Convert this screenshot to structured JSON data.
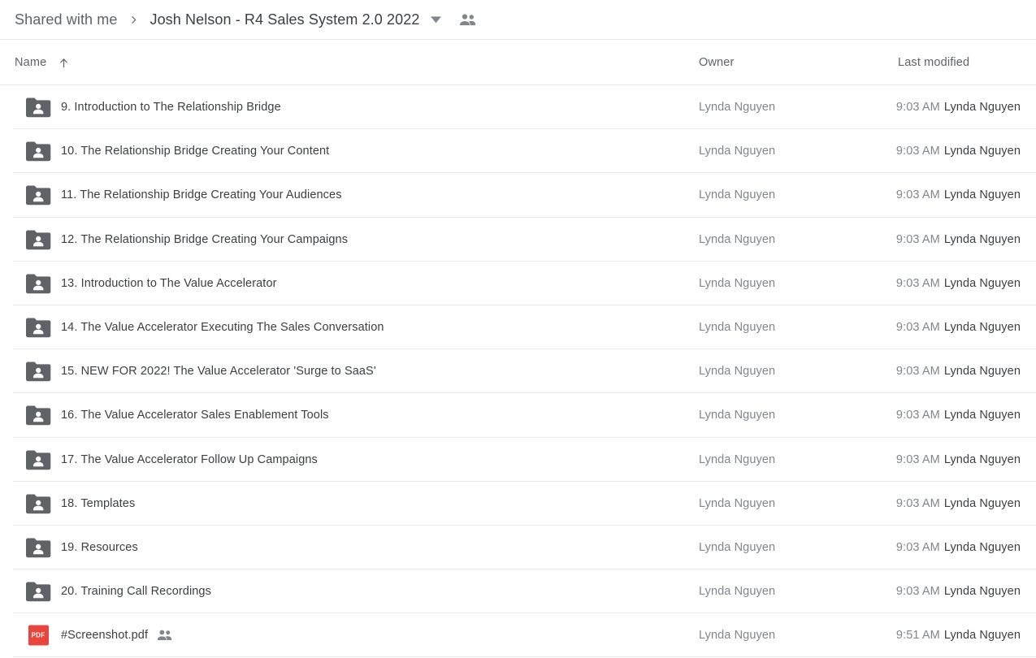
{
  "breadcrumb": {
    "parent_label": "Shared with me",
    "separator_icon": "chevron-right-icon",
    "current_label": "Josh Nelson - R4 Sales System 2.0 2022",
    "caret_icon": "chevron-down-icon",
    "shared_icon": "people-icon"
  },
  "columns": {
    "name_label": "Name",
    "sort_icon": "arrow-up-icon",
    "owner_label": "Owner",
    "modified_label": "Last modified"
  },
  "colors": {
    "folder_icon": "#5f6368",
    "pdf_badge": "#e8453c",
    "divider": "#e8eaed",
    "text_primary": "#3c4043",
    "text_secondary": "#5f6368",
    "text_muted": "#80868b"
  },
  "files": [
    {
      "icon": "shared-folder-icon",
      "name": "9. Introduction to The Relationship Bridge",
      "shared": false,
      "owner": "Lynda Nguyen",
      "modified_time": "9:03 AM",
      "modified_by": "Lynda Nguyen"
    },
    {
      "icon": "shared-folder-icon",
      "name": "10. The Relationship Bridge Creating Your Content",
      "shared": false,
      "owner": "Lynda Nguyen",
      "modified_time": "9:03 AM",
      "modified_by": "Lynda Nguyen"
    },
    {
      "icon": "shared-folder-icon",
      "name": "11. The Relationship Bridge Creating Your Audiences",
      "shared": false,
      "owner": "Lynda Nguyen",
      "modified_time": "9:03 AM",
      "modified_by": "Lynda Nguyen"
    },
    {
      "icon": "shared-folder-icon",
      "name": "12. The Relationship Bridge Creating Your Campaigns",
      "shared": false,
      "owner": "Lynda Nguyen",
      "modified_time": "9:03 AM",
      "modified_by": "Lynda Nguyen"
    },
    {
      "icon": "shared-folder-icon",
      "name": "13. Introduction to The Value Accelerator",
      "shared": false,
      "owner": "Lynda Nguyen",
      "modified_time": "9:03 AM",
      "modified_by": "Lynda Nguyen"
    },
    {
      "icon": "shared-folder-icon",
      "name": "14. The Value Accelerator Executing The Sales Conversation",
      "shared": false,
      "owner": "Lynda Nguyen",
      "modified_time": "9:03 AM",
      "modified_by": "Lynda Nguyen"
    },
    {
      "icon": "shared-folder-icon",
      "name": "15. NEW FOR 2022! The Value Accelerator 'Surge to SaaS'",
      "shared": false,
      "owner": "Lynda Nguyen",
      "modified_time": "9:03 AM",
      "modified_by": "Lynda Nguyen"
    },
    {
      "icon": "shared-folder-icon",
      "name": "16. The Value Accelerator Sales Enablement Tools",
      "shared": false,
      "owner": "Lynda Nguyen",
      "modified_time": "9:03 AM",
      "modified_by": "Lynda Nguyen"
    },
    {
      "icon": "shared-folder-icon",
      "name": "17. The Value Accelerator Follow Up Campaigns",
      "shared": false,
      "owner": "Lynda Nguyen",
      "modified_time": "9:03 AM",
      "modified_by": "Lynda Nguyen"
    },
    {
      "icon": "shared-folder-icon",
      "name": "18. Templates",
      "shared": false,
      "owner": "Lynda Nguyen",
      "modified_time": "9:03 AM",
      "modified_by": "Lynda Nguyen"
    },
    {
      "icon": "shared-folder-icon",
      "name": "19. Resources",
      "shared": false,
      "owner": "Lynda Nguyen",
      "modified_time": "9:03 AM",
      "modified_by": "Lynda Nguyen"
    },
    {
      "icon": "shared-folder-icon",
      "name": "20. Training Call Recordings",
      "shared": false,
      "owner": "Lynda Nguyen",
      "modified_time": "9:03 AM",
      "modified_by": "Lynda Nguyen"
    },
    {
      "icon": "pdf-file-icon",
      "badge_label": "PDF",
      "name": "#Screenshot.pdf",
      "shared": true,
      "owner": "Lynda Nguyen",
      "modified_time": "9:51 AM",
      "modified_by": "Lynda Nguyen"
    }
  ]
}
